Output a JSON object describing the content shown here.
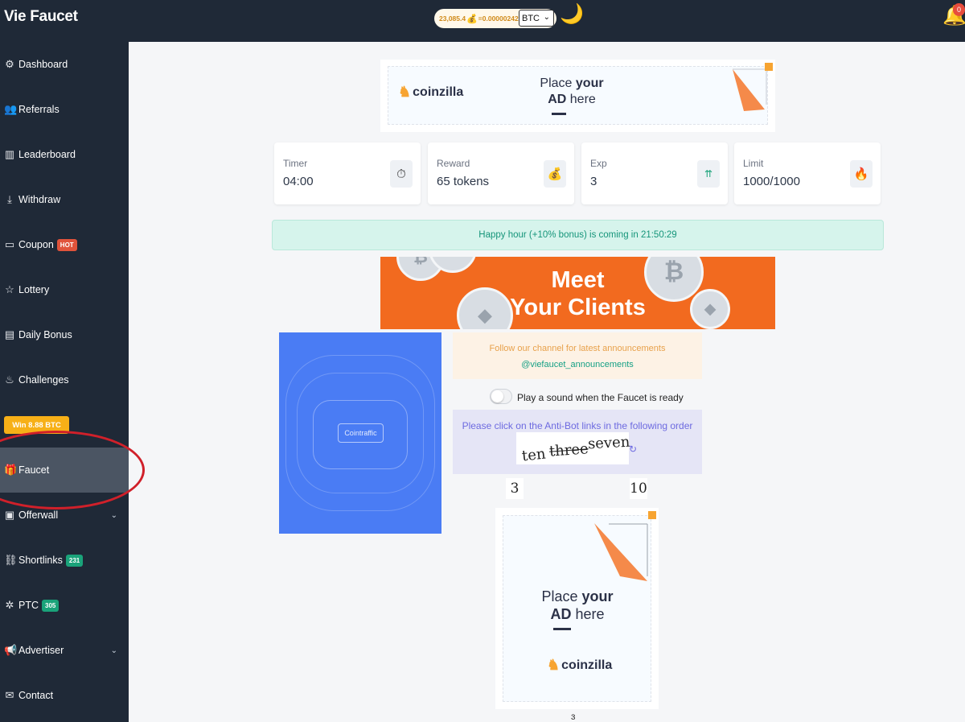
{
  "app": {
    "title": "Vie Faucet"
  },
  "header": {
    "balance_tokens": "23,085.4",
    "balance_eq": "=0.00000242",
    "currency": "BTC",
    "notifications": "0"
  },
  "sidebar": {
    "items": [
      {
        "label": "Dashboard",
        "icon": "gauge-icon"
      },
      {
        "label": "Referrals",
        "icon": "users-icon"
      },
      {
        "label": "Leaderboard",
        "icon": "chart-bar-icon"
      },
      {
        "label": "Withdraw",
        "icon": "download-icon"
      },
      {
        "label": "Coupon",
        "icon": "ticket-icon",
        "badge": "HOT"
      },
      {
        "label": "Lottery",
        "icon": "star-icon"
      },
      {
        "label": "Daily Bonus",
        "icon": "calendar-icon"
      },
      {
        "label": "Challenges",
        "icon": "flame-icon"
      },
      {
        "label": "Faucet",
        "icon": "gift-icon",
        "active": true
      },
      {
        "label": "Offerwall",
        "icon": "briefcase-icon",
        "expandable": true
      },
      {
        "label": "Shortlinks",
        "icon": "link-icon",
        "badge": "231"
      },
      {
        "label": "PTC",
        "icon": "cursor-click-icon",
        "badge": "305"
      },
      {
        "label": "Advertiser",
        "icon": "megaphone-icon",
        "expandable": true
      },
      {
        "label": "Contact",
        "icon": "mail-icon"
      }
    ],
    "win_button": "Win 8.88 BTC"
  },
  "ads": {
    "place_line1_a": "Place",
    "place_line1_b": "your",
    "place_line2_a": "AD",
    "place_line2_b": "here",
    "brand": "coinzilla",
    "meet_line1": "Meet",
    "meet_line2": "Your Clients",
    "cointraffic": "Cointraffic"
  },
  "stats": {
    "timer_label": "Timer",
    "timer_value": "04:00",
    "reward_label": "Reward",
    "reward_value": "65 tokens",
    "exp_label": "Exp",
    "exp_value": "3",
    "limit_label": "Limit",
    "limit_value": "1000/1000"
  },
  "happy_hour": "Happy hour (+10% bonus) is coming in 21:50:29",
  "channel": {
    "line1": "Follow our channel for latest announcements",
    "line2": "@viefaucet_announcements"
  },
  "sound_toggle": {
    "label": "Play a sound when the Faucet is ready",
    "checked": false
  },
  "antibot": {
    "message": "Please click on the Anti-Bot links in the following order",
    "captcha_words": [
      "ten",
      "three",
      "seven"
    ],
    "links": [
      "3",
      "10"
    ]
  },
  "colors": {
    "sidebar_bg": "#1f2937",
    "accent_green": "#1aa37a",
    "accent_orange": "#f26a1f",
    "highlight_circle": "#d0202a"
  }
}
